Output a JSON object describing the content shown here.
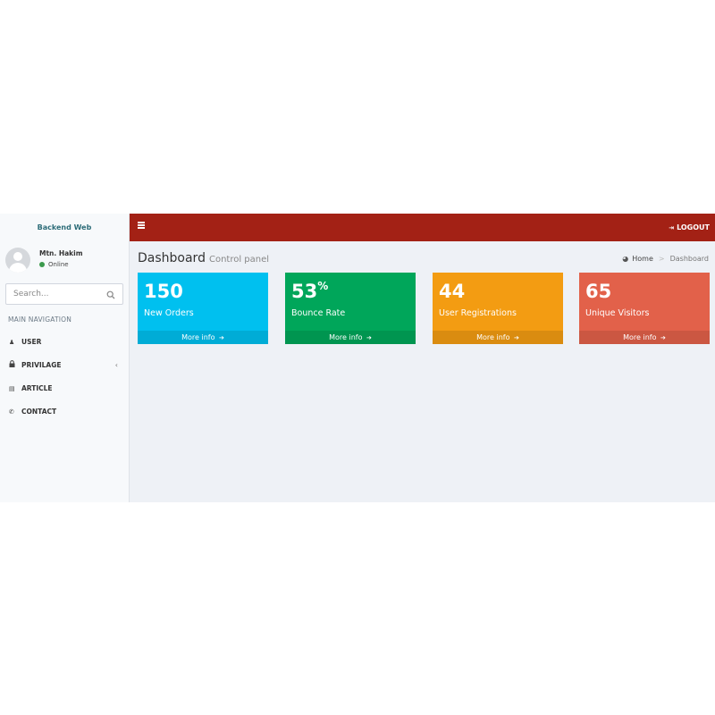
{
  "sidebar": {
    "brand": "Backend Web",
    "user": {
      "name": "Mtn. Hakim",
      "status": "Online"
    },
    "search": {
      "placeholder": "Search..."
    },
    "nav_header": "MAIN NAVIGATION",
    "items": [
      {
        "label": "USER",
        "icon": "user-icon",
        "glyph": "♟"
      },
      {
        "label": "PRIVILAGE",
        "icon": "lock-icon",
        "glyph": "🔒"
      },
      {
        "label": "ARTICLE",
        "icon": "book-icon",
        "glyph": "▤"
      },
      {
        "label": "CONTACT",
        "icon": "phone-icon",
        "glyph": "✆"
      }
    ]
  },
  "topbar": {
    "logout_label": "LOGOUT"
  },
  "content": {
    "title": "Dashboard",
    "subtitle": "Control panel",
    "breadcrumb": {
      "home": "Home",
      "current": "Dashboard"
    }
  },
  "stats": [
    {
      "value": "150",
      "suffix": "",
      "label": "New Orders",
      "footer": "More info",
      "color": "#00c0ef"
    },
    {
      "value": "53",
      "suffix": "%",
      "label": "Bounce Rate",
      "footer": "More info",
      "color": "#00a65a"
    },
    {
      "value": "44",
      "suffix": "",
      "label": "User Registrations",
      "footer": "More info",
      "color": "#f39c12"
    },
    {
      "value": "65",
      "suffix": "",
      "label": "Unique Visitors",
      "footer": "More info",
      "color": "#e2614a"
    }
  ],
  "colors": {
    "topbar": "#a32115",
    "online": "#3c9a4d",
    "brand_text": "#2e6d79"
  }
}
